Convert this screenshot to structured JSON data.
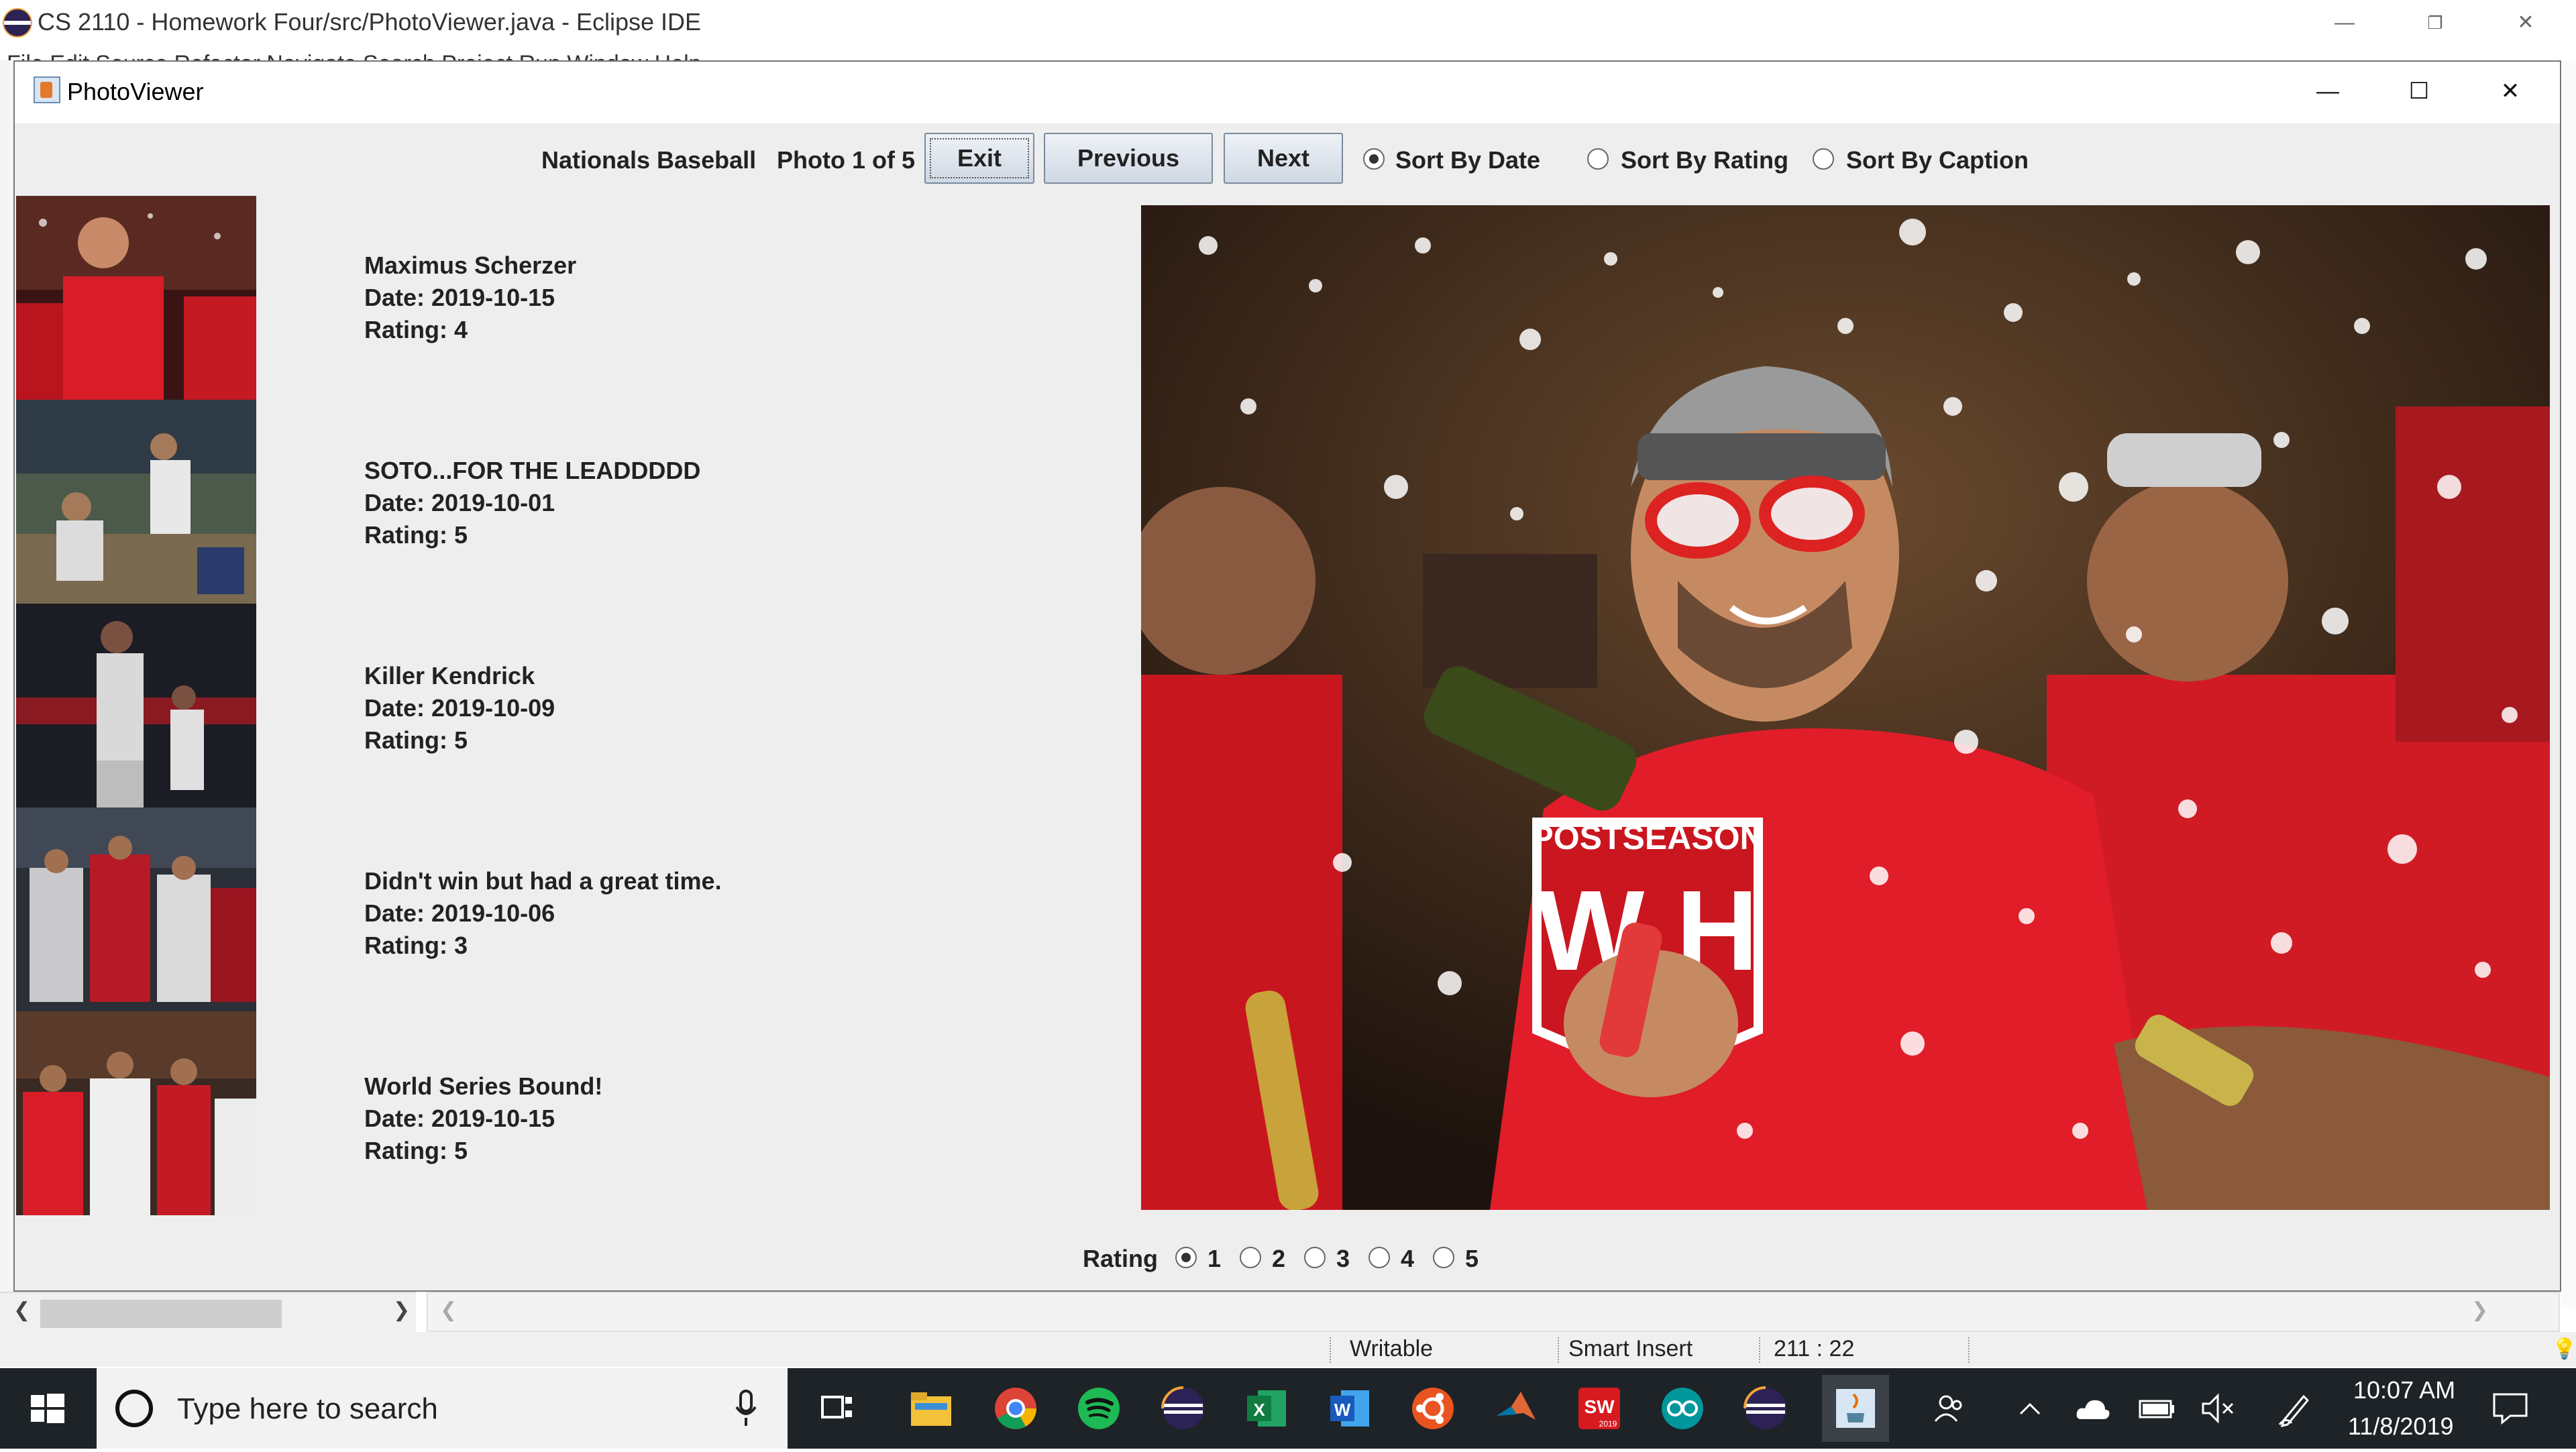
{
  "eclipse": {
    "title": "CS 2110 - Homework Four/src/PhotoViewer.java - Eclipse IDE",
    "menu_partial": "File  Edit  Source  Refactor  Navigate  Search  Project  Run  Window  Help",
    "status": {
      "writable": "Writable",
      "insert_mode": "Smart Insert",
      "position": "211 : 22"
    }
  },
  "photo_viewer": {
    "window_title": "PhotoViewer",
    "album_name": "Nationals Baseball",
    "photo_counter": "Photo 1 of 5",
    "buttons": {
      "exit": "Exit",
      "previous": "Previous",
      "next": "Next"
    },
    "sort_options": [
      {
        "label": "Sort By Date",
        "selected": true
      },
      {
        "label": "Sort By Rating",
        "selected": false
      },
      {
        "label": "Sort By Caption",
        "selected": false
      }
    ],
    "photos": [
      {
        "caption": "Maximus Scherzer",
        "date": "Date: 2019-10-15",
        "rating": "Rating: 4"
      },
      {
        "caption": "SOTO...FOR THE LEADDDDD",
        "date": "Date: 2019-10-01",
        "rating": "Rating: 5"
      },
      {
        "caption": "Killer Kendrick",
        "date": "Date: 2019-10-09",
        "rating": "Rating: 5"
      },
      {
        "caption": "Didn't win but had a great time.",
        "date": "Date: 2019-10-06",
        "rating": "Rating: 3"
      },
      {
        "caption": "World Series Bound!",
        "date": "Date: 2019-10-15",
        "rating": "Rating: 5"
      }
    ],
    "main_photo_text": {
      "shirt_top": "POSTSEASON",
      "shirt_logo": "W H"
    },
    "rating_label": "Rating",
    "rating_options": [
      {
        "label": "1",
        "selected": true
      },
      {
        "label": "2",
        "selected": false
      },
      {
        "label": "3",
        "selected": false
      },
      {
        "label": "4",
        "selected": false
      },
      {
        "label": "5",
        "selected": false
      }
    ]
  },
  "taskbar": {
    "search_placeholder": "Type here to search",
    "apps": [
      "task-view-icon",
      "file-explorer-icon",
      "chrome-icon",
      "spotify-icon",
      "eclipse-icon",
      "excel-icon",
      "word-icon",
      "ubuntu-icon",
      "matlab-icon",
      "solidworks-icon",
      "arduino-icon",
      "eclipse-icon",
      "java-icon"
    ],
    "solidworks_year": "2019",
    "clock": {
      "time": "10:07 AM",
      "date": "11/8/2019"
    }
  },
  "colors": {
    "nationals_red": "#d81c28",
    "taskbar": "#1e2327",
    "window_bg": "#eeeeee"
  }
}
